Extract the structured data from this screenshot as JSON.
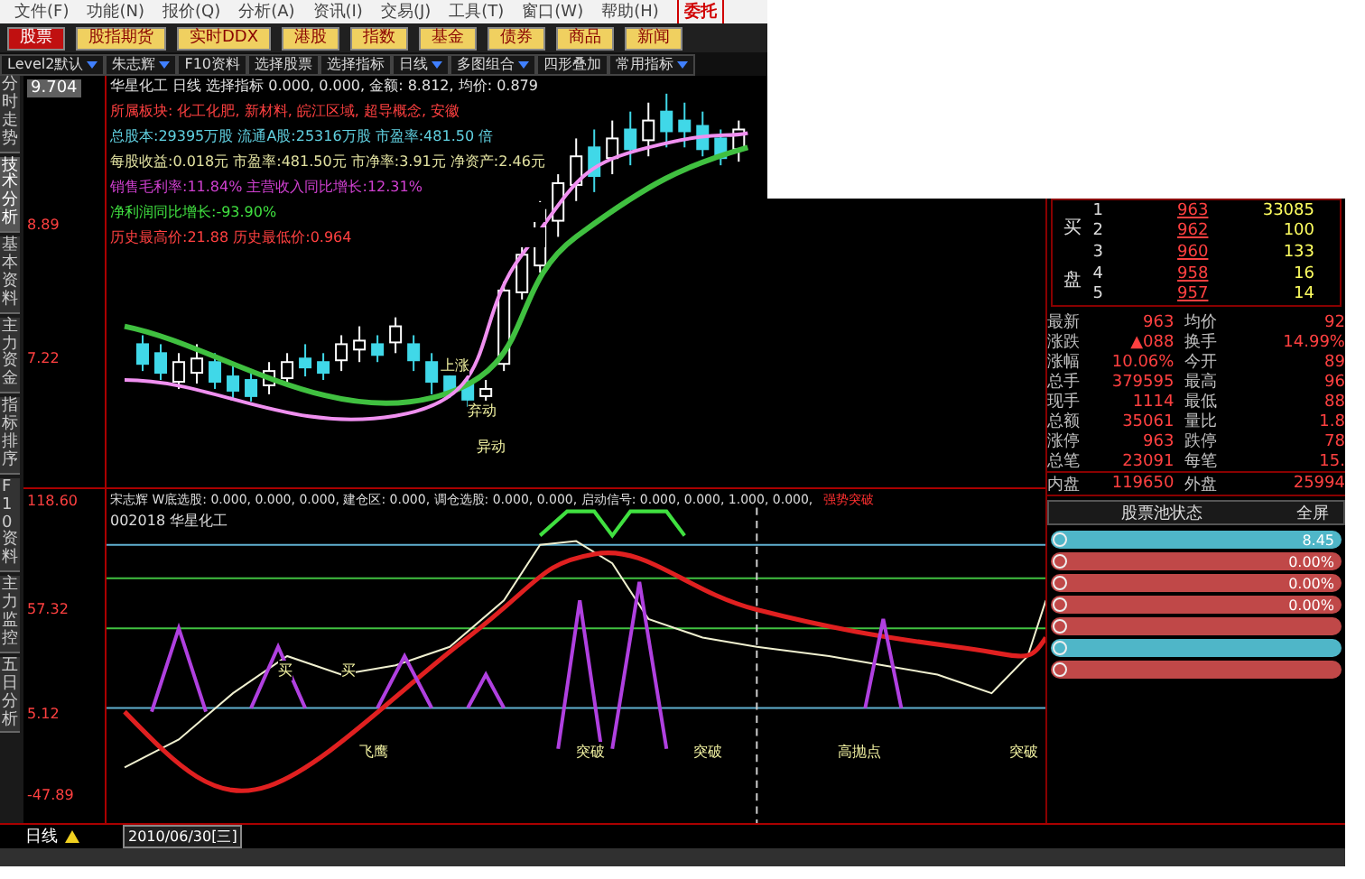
{
  "menu": [
    {
      "label": "文件(F)",
      "selected": false
    },
    {
      "label": "功能(N)",
      "selected": false
    },
    {
      "label": "报价(Q)",
      "selected": false
    },
    {
      "label": "分析(A)",
      "selected": false
    },
    {
      "label": "资讯(I)",
      "selected": false
    },
    {
      "label": "交易(J)",
      "selected": false
    },
    {
      "label": "工具(T)",
      "selected": false
    },
    {
      "label": "窗口(W)",
      "selected": false
    },
    {
      "label": "帮助(H)",
      "selected": false
    },
    {
      "label": "委托",
      "selected": true
    }
  ],
  "market_tabs": [
    {
      "label": "股票",
      "selected": true
    },
    {
      "label": "股指期货",
      "selected": false
    },
    {
      "label": "实时DDX",
      "selected": false
    },
    {
      "label": "港股",
      "selected": false
    },
    {
      "label": "指数",
      "selected": false
    },
    {
      "label": "基金",
      "selected": false
    },
    {
      "label": "债券",
      "selected": false
    },
    {
      "label": "商品",
      "selected": false
    },
    {
      "label": "新闻",
      "selected": false
    }
  ],
  "toolbar": [
    {
      "label": "Level2默认",
      "dropdown": true
    },
    {
      "label": "朱志辉",
      "dropdown": true
    },
    {
      "label": "F10资料",
      "dropdown": false
    },
    {
      "label": "选择股票",
      "dropdown": false
    },
    {
      "label": "选择指标",
      "dropdown": false
    },
    {
      "label": "日线",
      "dropdown": true
    },
    {
      "label": "多图组合",
      "dropdown": true
    },
    {
      "label": "四形叠加",
      "dropdown": false
    },
    {
      "label": "常用指标",
      "dropdown": true
    }
  ],
  "side_tabs": [
    {
      "label": "分时走势",
      "selected": false
    },
    {
      "label": "技术分析",
      "selected": true
    },
    {
      "label": "基本资料",
      "selected": false
    },
    {
      "label": "主力资金",
      "selected": false
    },
    {
      "label": "指标排序",
      "selected": false
    },
    {
      "label": "F10资料",
      "selected": false
    },
    {
      "label": "主力监控",
      "selected": false
    },
    {
      "label": "五日分析",
      "selected": false
    }
  ],
  "upper_chart": {
    "price_box": "9.704",
    "axis": [
      "8.89",
      "7.22"
    ],
    "info": [
      {
        "text": "华星化工 日线 选择指标 0.000, 0.000, 金额: 8.812, 均价: 0.879",
        "color": "#e0e0e0"
      },
      {
        "text": "所属板块: 化工化肥, 新材料, 皖江区域, 超导概念, 安徽",
        "color": "#ff4040"
      },
      {
        "text": "总股本:29395万股  流通A股:25316万股  市盈率:481.50 倍",
        "color": "#60d0e0"
      },
      {
        "text": "每股收益:0.018元  市盈率:481.50元  市净率:3.91元  净资产:2.46元",
        "color": "#e0e0a0"
      },
      {
        "text": "销售毛利率:11.84%     主营收入同比增长:12.31%",
        "color": "#d040d0"
      },
      {
        "text": "净利润同比增长:-93.90%",
        "color": "#40e040"
      },
      {
        "text": "历史最高价:21.88     历史最低价:0.964",
        "color": "#ff4040"
      }
    ],
    "markers": [
      "上涨",
      "弃动",
      "异动"
    ]
  },
  "lower_chart": {
    "title": "宋志辉 W底选股: 0.000, 0.000, 0.000, 建仓区: 0.000,        调仓选股: 0.000,       0.000, 启动信号: 0.000, 0.000, 1.000, 0.000,",
    "alert": "强势突破",
    "code": "002018 华星化工",
    "axis": [
      "118.60",
      "57.32",
      "5.12",
      "-47.89"
    ],
    "markers": [
      "买",
      "买",
      "飞鹰",
      "突破",
      "突破",
      "高抛点",
      "突破"
    ]
  },
  "bottom_bar": {
    "period": "日线",
    "date": "2010/06/30[三]"
  },
  "order_book": {
    "side_labels": [
      "买",
      "盘"
    ],
    "rows": [
      {
        "level": "1",
        "price": "963",
        "volume": "33085"
      },
      {
        "level": "2",
        "price": "962",
        "volume": "100"
      },
      {
        "level": "3",
        "price": "960",
        "volume": "133"
      },
      {
        "level": "4",
        "price": "958",
        "volume": "16"
      },
      {
        "level": "5",
        "price": "957",
        "volume": "14"
      }
    ]
  },
  "quote_stats": [
    {
      "label": "最新",
      "value": "963",
      "label2": "均价",
      "value2": "92"
    },
    {
      "label": "涨跌",
      "value": "▲088",
      "label2": "换手",
      "value2": "14.99%"
    },
    {
      "label": "涨幅",
      "value": "10.06%",
      "label2": "今开",
      "value2": "89"
    },
    {
      "label": "总手",
      "value": "379595",
      "label2": "最高",
      "value2": "96"
    },
    {
      "label": "现手",
      "value": "1114",
      "label2": "最低",
      "value2": "88"
    },
    {
      "label": "总额",
      "value": "35061",
      "label2": "量比",
      "value2": "1.8"
    },
    {
      "label": "涨停",
      "value": "963",
      "label2": "跌停",
      "value2": "78"
    },
    {
      "label": "总笔",
      "value": "23091",
      "label2": "每笔",
      "value2": "15."
    },
    {
      "label": "内盘",
      "value": "119650",
      "label2": "外盘",
      "value2": "25994"
    }
  ],
  "pool": {
    "title": "股票池状态",
    "fullscreen": "全屏",
    "items": [
      {
        "color": "#4fb6c8",
        "value": "8.45"
      },
      {
        "color": "#c04848",
        "value": "0.00%"
      },
      {
        "color": "#c04848",
        "value": "0.00%"
      },
      {
        "color": "#c04848",
        "value": "0.00%"
      },
      {
        "color": "#c04848"
      },
      {
        "color": "#4fb6c8"
      },
      {
        "color": "#c04848"
      }
    ]
  }
}
